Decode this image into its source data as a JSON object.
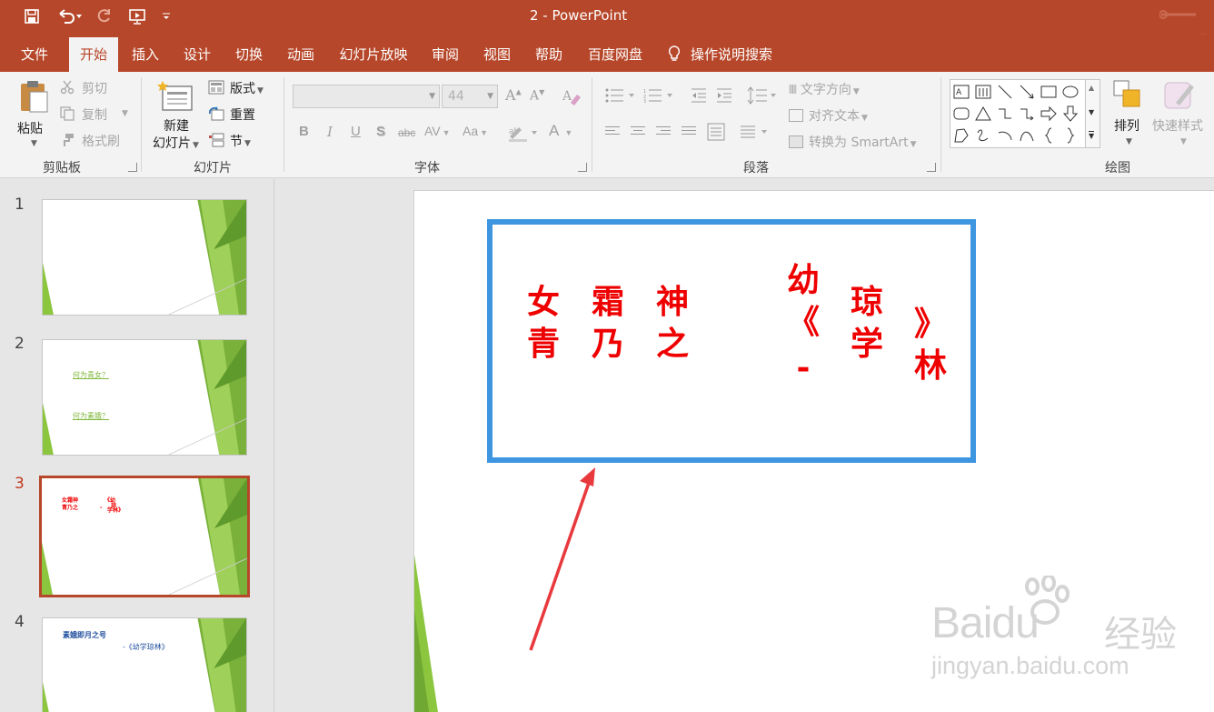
{
  "window": {
    "title": "2  -  PowerPoint"
  },
  "quick_access": {
    "icons": [
      "save-icon",
      "undo-icon",
      "redo-icon",
      "slideshow-from-beginning-icon",
      "customize-qat-icon"
    ]
  },
  "tabs": [
    {
      "label": "文件",
      "active": false
    },
    {
      "label": "开始",
      "active": true
    },
    {
      "label": "插入",
      "active": false
    },
    {
      "label": "设计",
      "active": false
    },
    {
      "label": "切换",
      "active": false
    },
    {
      "label": "动画",
      "active": false
    },
    {
      "label": "幻灯片放映",
      "active": false
    },
    {
      "label": "审阅",
      "active": false
    },
    {
      "label": "视图",
      "active": false
    },
    {
      "label": "帮助",
      "active": false
    },
    {
      "label": "百度网盘",
      "active": false
    }
  ],
  "tell_me": {
    "label": "操作说明搜索"
  },
  "ribbon": {
    "clipboard": {
      "paste": "粘贴",
      "cut": "剪切",
      "copy": "复制",
      "format_painter": "格式刷",
      "group": "剪贴板"
    },
    "slides": {
      "new_slide_1": "新建",
      "new_slide_2": "幻灯片",
      "layout": "版式",
      "reset": "重置",
      "section": "节",
      "group": "幻灯片"
    },
    "font": {
      "font_size": "44",
      "bold": "B",
      "italic": "I",
      "underline": "U",
      "shadow": "S",
      "strike": "abc",
      "spacing": "AV",
      "case": "Aa",
      "color": "A",
      "group": "字体"
    },
    "paragraph": {
      "text_direction": "文字方向",
      "align_text": "对齐文本",
      "smartart": "转换为 SmartArt",
      "group": "段落"
    },
    "drawing": {
      "arrange": "排列",
      "quick_styles": "快速样式",
      "group": "绘图"
    }
  },
  "thumbnails": [
    {
      "number": "1",
      "selected": false,
      "lines": []
    },
    {
      "number": "2",
      "selected": false,
      "lines": [
        "何为青女？",
        "何为素娥？"
      ]
    },
    {
      "number": "3",
      "selected": true,
      "lines": []
    },
    {
      "number": "4",
      "selected": false,
      "lines": [
        "素娥即月之号",
        "-《幼学琼林》"
      ]
    }
  ],
  "slide": {
    "columns": [
      [
        "青",
        "女"
      ],
      [
        "乃",
        "霜"
      ],
      [
        "之",
        "神"
      ],
      [
        "-",
        ""
      ],
      [
        "《",
        "幼"
      ],
      [
        "学",
        "琼"
      ],
      [
        "林",
        "》"
      ]
    ]
  },
  "watermark": {
    "logo": "Baidu",
    "brand": "经验",
    "url": "jingyan.baidu.com"
  },
  "colors": {
    "accent": "#b7472a",
    "textbox_border": "#3e95e0",
    "slide_text": "#ef0000",
    "arrow": "#e8393d",
    "thumb_green": "#8cc63f"
  }
}
